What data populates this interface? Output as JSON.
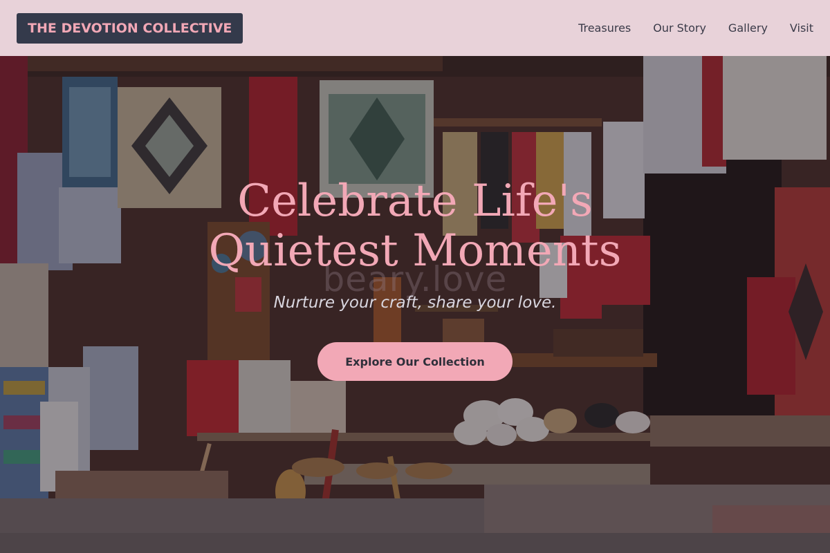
{
  "brand": {
    "name": "THE DEVOTION COLLECTIVE"
  },
  "nav": {
    "items": [
      "Treasures",
      "Our Story",
      "Gallery",
      "Visit"
    ]
  },
  "hero": {
    "title": "Celebrate Life's Quietest Moments",
    "watermark": "beary.love",
    "subtitle": "Nurture your craft, share your love.",
    "cta": "Explore Our Collection"
  },
  "colors": {
    "header_bg": "#e8d2d9",
    "logo_bg": "#343a4b",
    "accent_pink": "#f2a8b6",
    "nav_text": "#3a3a48"
  }
}
